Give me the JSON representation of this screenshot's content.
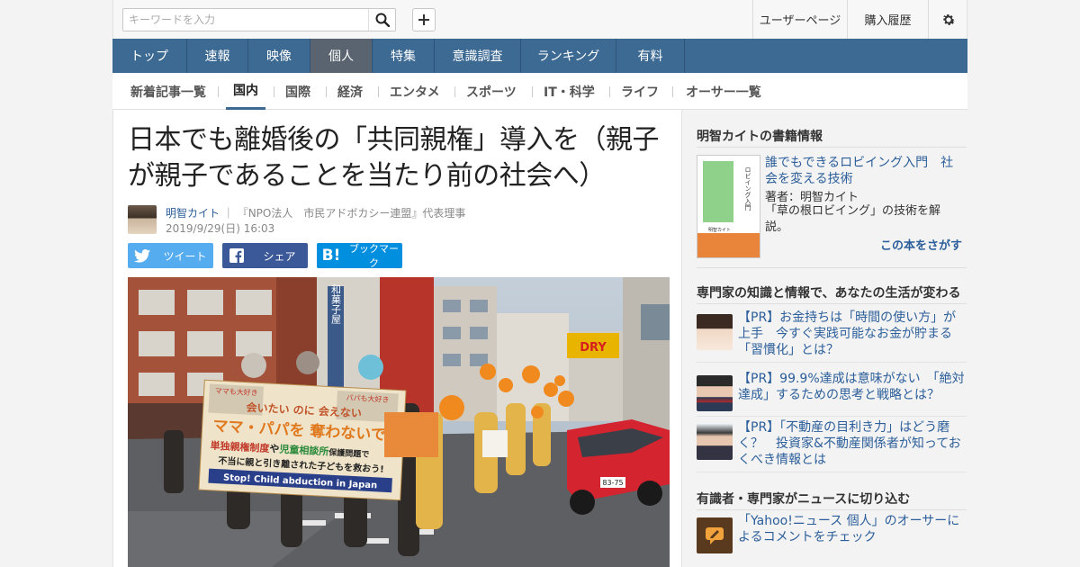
{
  "search": {
    "placeholder": "キーワードを入力"
  },
  "utility": {
    "user_page": "ユーザーページ",
    "purchase_history": "購入履歴"
  },
  "icons": {
    "search": "search-icon",
    "plus": "plus-icon",
    "gear": "gear-icon"
  },
  "main_nav": [
    {
      "label": "トップ",
      "active": false
    },
    {
      "label": "速報",
      "active": false
    },
    {
      "label": "映像",
      "active": false
    },
    {
      "label": "個人",
      "active": true
    },
    {
      "label": "特集",
      "active": false
    },
    {
      "label": "意識調査",
      "active": false
    },
    {
      "label": "ランキング",
      "active": false
    },
    {
      "label": "有料",
      "active": false
    }
  ],
  "sub_nav": [
    {
      "label": "新着記事一覧",
      "active": false
    },
    {
      "label": "国内",
      "active": true
    },
    {
      "label": "国際",
      "active": false
    },
    {
      "label": "経済",
      "active": false
    },
    {
      "label": "エンタメ",
      "active": false
    },
    {
      "label": "スポーツ",
      "active": false
    },
    {
      "label": "IT・科学",
      "active": false
    },
    {
      "label": "ライフ",
      "active": false
    },
    {
      "label": "オーサー一覧",
      "active": false
    }
  ],
  "article": {
    "title": "日本でも離婚後の「共同親権」導入を（親子が親子であることを当たり前の社会へ）",
    "author_name": "明智カイト",
    "author_sep": "｜",
    "author_role": "『NPO法人　市民アドボカシー連盟』代表理事",
    "date": "2019/9/29(日) 16:03",
    "share": {
      "tweet": "ツイート",
      "share": "シェア",
      "bookmark": "ブックマーク",
      "hatena_mark": "B!"
    },
    "photo": {
      "banner_top_left": "ママも大好き",
      "banner_top_right": "パパも大好き",
      "banner_line1": "会いたい のに 会えない",
      "banner_line2": "ママ・パパを 奪わないで!",
      "banner_line3a": "単独親権制度",
      "banner_line3b": "や",
      "banner_line3c": "児童相談所",
      "banner_line3d": "保護問題で",
      "banner_line4": "不当に親と引き離された子どもを救おう!",
      "banner_line5": "Stop! Child abduction in Japan",
      "building_sign": "和菓子屋",
      "car_plate": "83-75",
      "storefront_sign": "DRY"
    }
  },
  "sidebar": {
    "book_section_title": "明智カイトの書籍情報",
    "book": {
      "title": "誰でもできるロビイング入門　社会を変える技術",
      "author": "著者：明智カイト",
      "desc": "「草の根ロビイング」の技術を解説。",
      "find": "この本をさがす",
      "cover_title": "ロビイング入門",
      "cover_author": "明智カイト"
    },
    "pr_section_title": "専門家の知識と情報で、あなたの生活が変わる",
    "pr_items": [
      {
        "text": "【PR】お金持ちは「時間の使い方」が上手　今すぐ実践可能なお金が貯まる「習慣化」とは？"
      },
      {
        "text": "【PR】99.9%達成は意味がない　「絶対達成」するための思考と戦略とは？"
      },
      {
        "text": "【PR】「不動産の目利き力」はどう磨く？　投資家&不動産関係者が知っておくべき情報とは"
      }
    ],
    "expert_section_title": "有識者・専門家がニュースに切り込む",
    "expert_item": {
      "text": "「Yahoo!ニュース 個人」のオーサーによるコメントをチェック"
    }
  }
}
